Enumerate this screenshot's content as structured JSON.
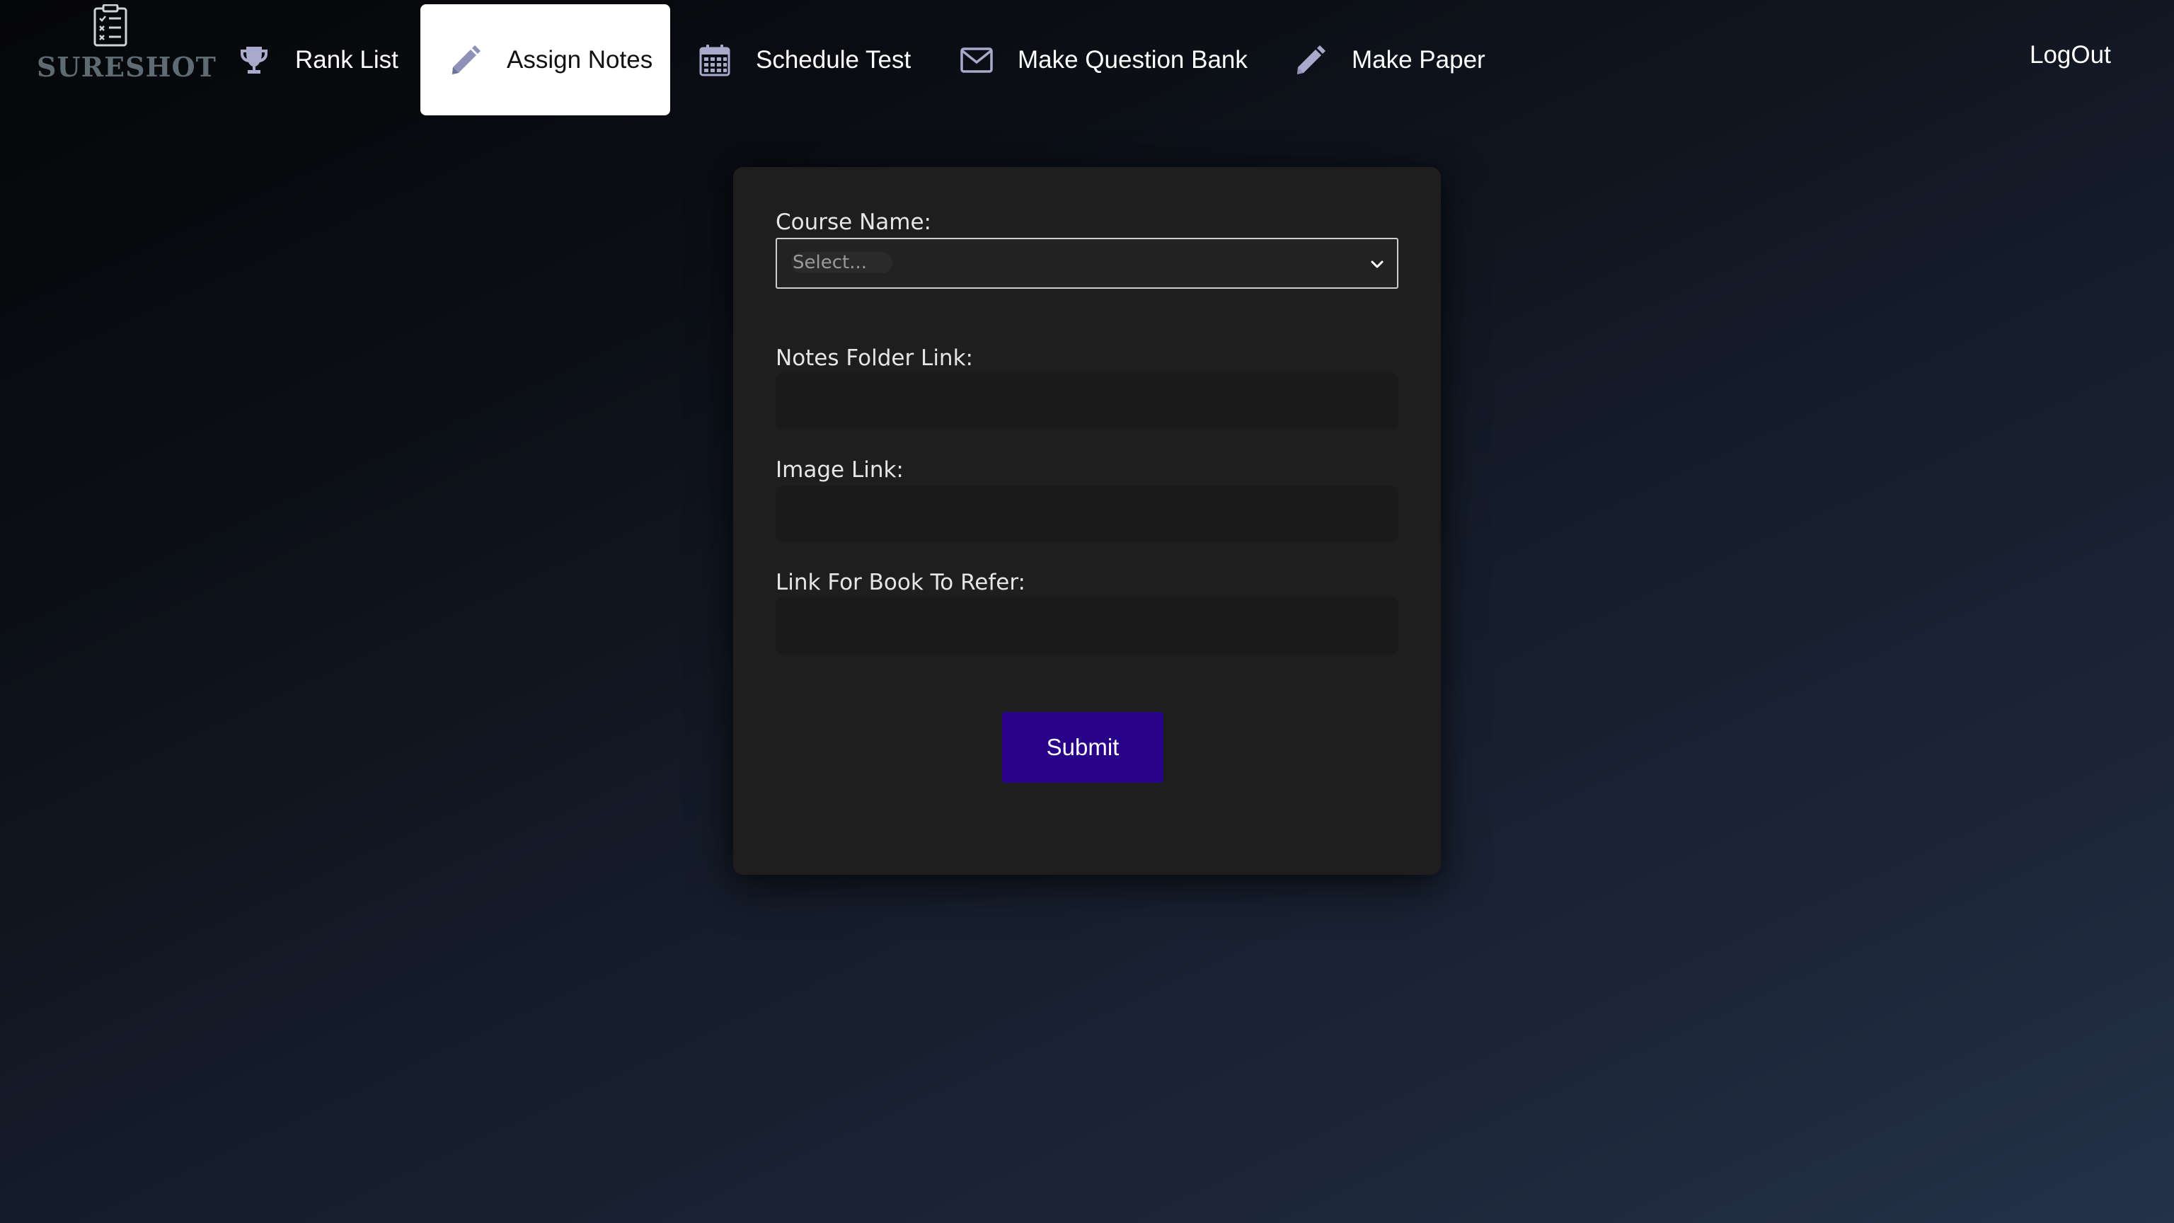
{
  "colors": {
    "accent": "#280288",
    "nav_icon": "#a7aacb",
    "active_tab_bg": "#ffffff",
    "card_bg": "#1e1e1e",
    "logo_text": "#5f6b72"
  },
  "brand": {
    "logo_text": "SURESHOT",
    "logo_icon": "clipboard-checklist-icon"
  },
  "nav": {
    "items": [
      {
        "label": "Rank List",
        "icon": "trophy-icon",
        "active": false
      },
      {
        "label": "Assign Notes",
        "icon": "pencil-icon",
        "active": true
      },
      {
        "label": "Schedule Test",
        "icon": "calendar-icon",
        "active": false
      },
      {
        "label": "Make Question Bank",
        "icon": "envelope-icon",
        "active": false
      },
      {
        "label": "Make Paper",
        "icon": "pencil-icon",
        "active": false
      }
    ],
    "logout_label": "LogOut"
  },
  "form": {
    "course_name": {
      "label": "Course Name:",
      "placeholder": "Select...",
      "value": ""
    },
    "notes_folder_link": {
      "label": "Notes Folder Link:",
      "value": ""
    },
    "image_link": {
      "label": "Image Link:",
      "value": ""
    },
    "book_link": {
      "label": "Link For Book To Refer:",
      "value": ""
    },
    "submit_label": "Submit"
  }
}
